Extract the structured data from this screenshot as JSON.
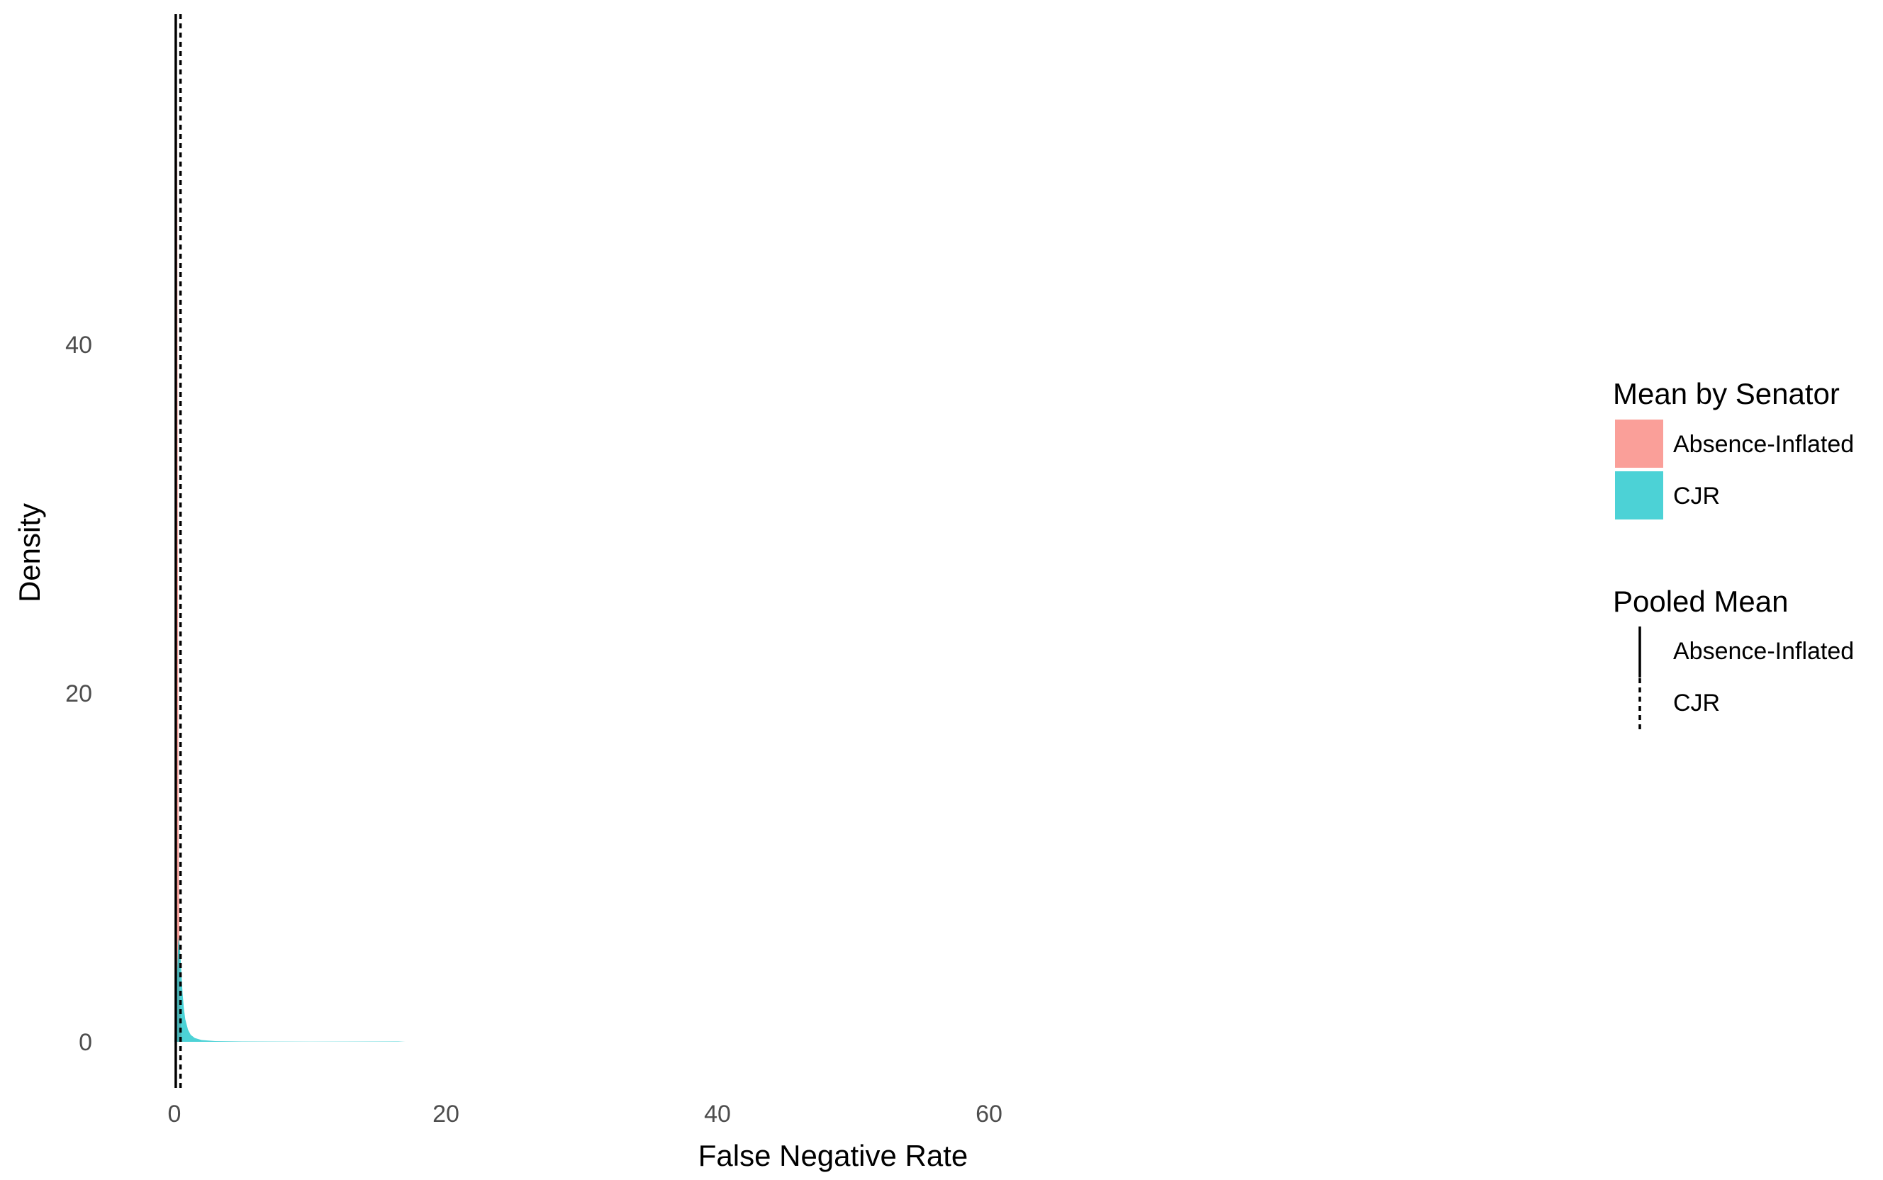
{
  "chart_data": {
    "type": "area",
    "xlabel": "False Negative Rate",
    "ylabel": "Density",
    "xlim": [
      -4.2,
      80
    ],
    "ylim": [
      -3,
      59
    ],
    "x_ticks": [
      0,
      20,
      40,
      60
    ],
    "y_ticks": [
      0,
      20,
      40
    ],
    "grid": false,
    "series": [
      {
        "name": "Absence-Inflated",
        "color": "#F8766D",
        "opacity": 0.7,
        "x": [
          0.0,
          0.05,
          0.1,
          0.15,
          0.2,
          0.25,
          0.3,
          0.4,
          0.5,
          0.6
        ],
        "y": [
          0,
          2,
          12,
          30,
          55,
          30,
          12,
          3,
          0.5,
          0
        ]
      },
      {
        "name": "CJR",
        "color": "#00BFC4",
        "opacity": 0.7,
        "x": [
          0.0,
          0.1,
          0.2,
          0.3,
          0.4,
          0.5,
          0.6,
          0.7,
          0.8,
          1.0,
          1.2,
          1.5,
          2.0,
          3.0,
          5.0,
          10.0,
          16.5,
          17.0
        ],
        "y": [
          0,
          2,
          4,
          6,
          5.5,
          4.2,
          2.8,
          1.9,
          1.3,
          0.7,
          0.4,
          0.22,
          0.1,
          0.04,
          0.02,
          0.01,
          0.02,
          0
        ]
      }
    ],
    "reference_lines": [
      {
        "name": "Absence-Inflated",
        "x": 0.1,
        "style": "solid"
      },
      {
        "name": "CJR",
        "x": 0.45,
        "style": "dotted"
      }
    ],
    "legend_fill": {
      "title": "Mean by Senator",
      "items": [
        {
          "label": "Absence-Inflated",
          "color": "#F8766D"
        },
        {
          "label": "CJR",
          "color": "#00BFC4"
        }
      ]
    },
    "legend_line": {
      "title": "Pooled Mean",
      "items": [
        {
          "label": "Absence-Inflated",
          "style": "solid"
        },
        {
          "label": "CJR",
          "style": "dotted"
        }
      ]
    },
    "legend_position": "right"
  }
}
